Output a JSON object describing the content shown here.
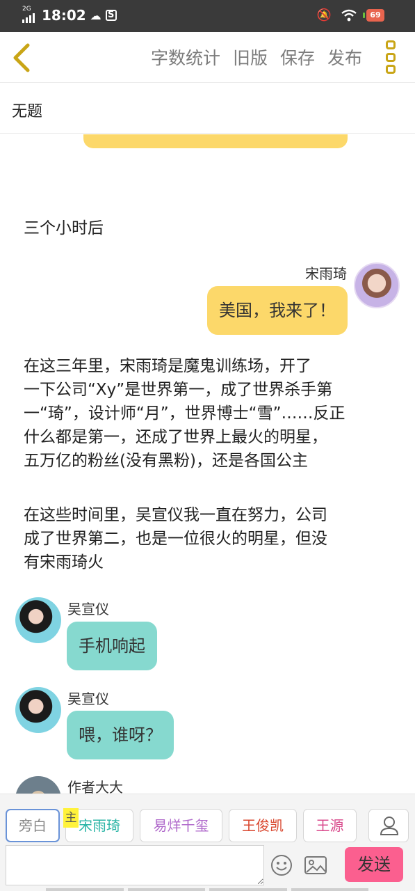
{
  "status_bar": {
    "network": "2G",
    "time": "18:02",
    "battery": "69"
  },
  "toolbar": {
    "word_count": "字数统计",
    "old_version": "旧版",
    "save": "保存",
    "publish": "发布"
  },
  "document": {
    "title": "无题"
  },
  "story": {
    "narration_1": "三个小时后",
    "song_name": "宋雨琦",
    "song_bubble": "美国，我来了！",
    "narration_2_lines": [
      "在这三年里，宋雨琦是魔鬼训练场，开了",
      "一下公司“Xy”是世界第一，成了世界杀手第",
      "一“琦”，设计师“月”，世界博士“雪”……反正",
      "什么都是第一，还成了世界上最火的明星，",
      "五万亿的粉丝(没有黑粉)，还是各国公主"
    ],
    "narration_3_lines": [
      "在这些时间里，吴宣仪我一直在努力，公司",
      "成了世界第二，也是一位很火的明星，但没",
      "有宋雨琦火"
    ],
    "wu_name_1": "吴宣仪",
    "wu_bubble_1": "手机响起",
    "wu_name_2": "吴宣仪",
    "wu_bubble_2": "喂，谁呀？",
    "author_name": "作者大大"
  },
  "roles": {
    "narrator": "旁白",
    "main_tag": "主",
    "song": "宋雨琦",
    "yi": "易烊千玺",
    "wang_junkai": "王俊凯",
    "wang_yuan": "王源"
  },
  "input": {
    "value": "",
    "send": "发送"
  },
  "colors": {
    "yellow_bubble": "#fcd86a",
    "teal_bubble": "#86d9cf",
    "send_button": "#fb5f8f",
    "role_song": "#2bb5a6",
    "role_yi": "#b06acb",
    "role_wang_junkai": "#d9472f",
    "role_wang_yuan": "#d94a8c"
  }
}
